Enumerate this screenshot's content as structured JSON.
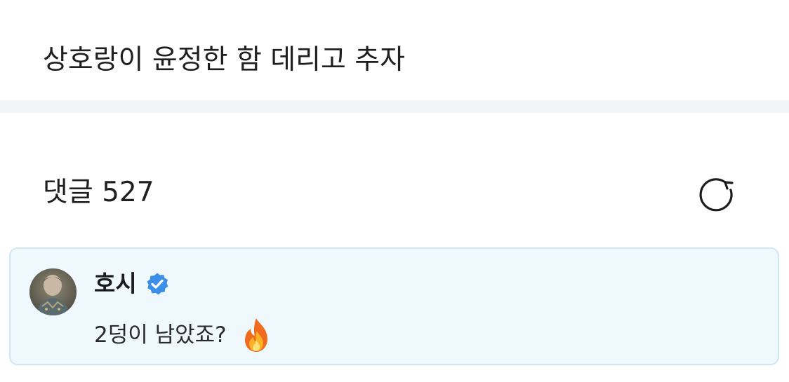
{
  "post": {
    "text": "상호랑이 윤정한 함 데리고 추자"
  },
  "comments_section": {
    "title": "댓글 527",
    "refresh_icon": "refresh-icon"
  },
  "highlighted_comment": {
    "author": "호시",
    "verified_icon": "verified-badge-icon",
    "text": "2덩이 남았죠?",
    "emoji": "fire-icon"
  },
  "colors": {
    "divider": "#f3f4f8",
    "card_background": "#eef8fd",
    "card_border": "#cfe7f2",
    "verified_blue": "#3b8fe8",
    "text_primary": "#1f1f21"
  }
}
